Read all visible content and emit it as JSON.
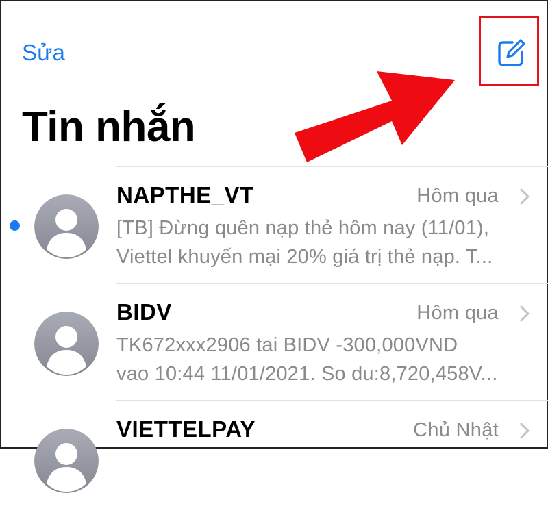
{
  "nav": {
    "edit_label": "Sửa",
    "compose_icon": "compose-icon"
  },
  "page": {
    "title": "Tin nhắn"
  },
  "colors": {
    "accent": "#1a7cf0",
    "highlight": "#e3121b",
    "arrow": "#ef0b12",
    "secondary_text": "#8a8a8e",
    "separator": "#e1e1e4"
  },
  "conversations": [
    {
      "sender": "NAPTHE_VT",
      "time": "Hôm qua",
      "unread": true,
      "preview_line1": "[TB] Đừng quên nạp thẻ hôm nay (11/01),",
      "preview_line2": "Viettel khuyến mại 20% giá trị thẻ nạp. T..."
    },
    {
      "sender": "BIDV",
      "time": "Hôm qua",
      "unread": false,
      "preview_line1": "TK672xxx2906 tai BIDV -300,000VND",
      "preview_line2": "vao 10:44 11/01/2021. So du:8,720,458V..."
    },
    {
      "sender": "VIETTELPAY",
      "time": "Chủ Nhật",
      "unread": false,
      "preview_line1": "",
      "preview_line2": ""
    }
  ]
}
